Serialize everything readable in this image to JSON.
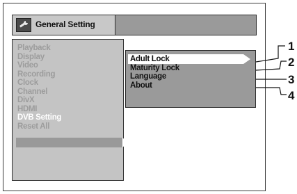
{
  "title_bar": {
    "title": "General Setting",
    "icon": "wrench-icon"
  },
  "menu": {
    "items": [
      "Playback",
      "Display",
      "Video",
      "Recording",
      "Clock",
      "Channel",
      "DivX",
      "HDMI",
      "DVB Setting",
      "Reset All"
    ],
    "selected": "DVB Setting"
  },
  "submenu": {
    "items": [
      "Adult Lock",
      "Maturity Lock",
      "Language",
      "About"
    ],
    "highlighted": "Adult Lock"
  },
  "callouts": [
    "1",
    "2",
    "3",
    "4"
  ],
  "colors": {
    "panel_gray": "#c4c4c4",
    "dark_gray": "#9a9a9a",
    "inactive_text": "#9c9c9c",
    "highlight": "#ffffff"
  }
}
